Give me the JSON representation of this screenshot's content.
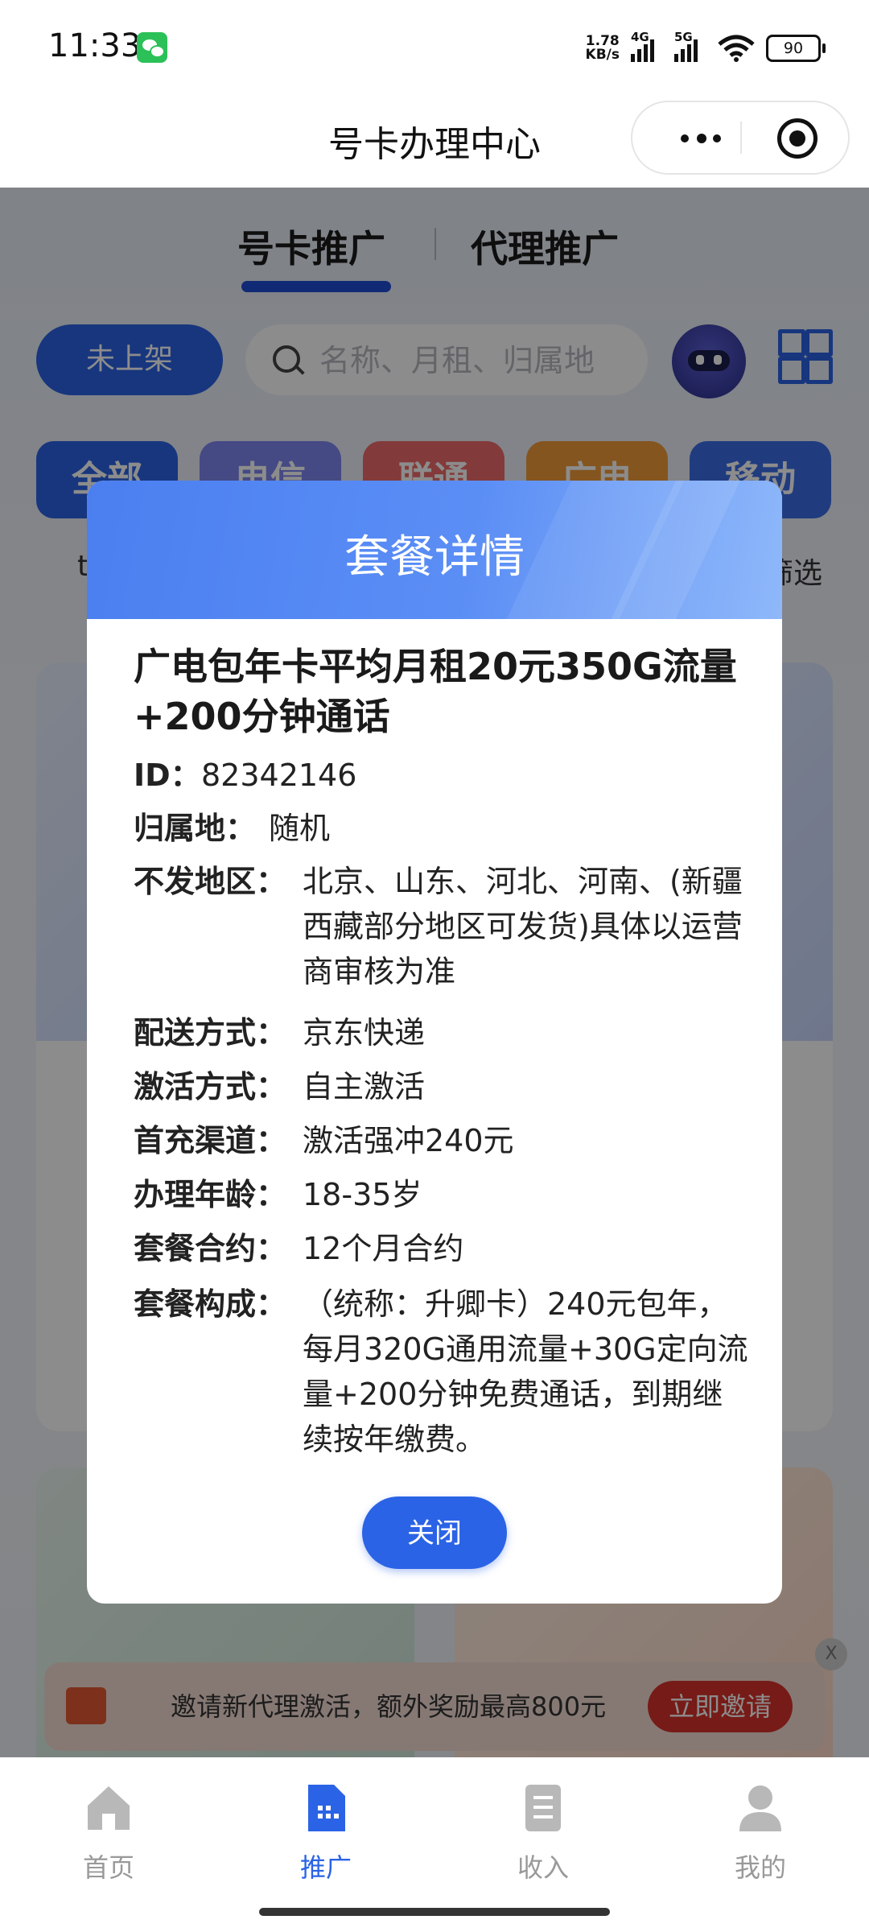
{
  "status_bar": {
    "time": "11:33",
    "net_speed_value": "1.78",
    "net_speed_unit": "KB/s",
    "sim1_tag": "4G",
    "sim2_tag": "5G",
    "battery": "90"
  },
  "title_bar": {
    "title": "号卡办理中心"
  },
  "tabs": {
    "active": "号卡推广",
    "other": "代理推广"
  },
  "filter": {
    "status_pill": "未上架",
    "search_placeholder": "名称、月租、归属地"
  },
  "carriers": [
    "全部",
    "电信",
    "联通",
    "广电",
    "移动"
  ],
  "sub_row": {
    "left_fragment": "t",
    "right_fragment": "筛选"
  },
  "invite": {
    "text": "邀请新代理激活，额外奖励最高800元",
    "button": "立即邀请",
    "close": "X"
  },
  "bottom_nav": [
    {
      "label": "首页",
      "icon": "home-icon",
      "active": false
    },
    {
      "label": "推广",
      "icon": "sim-card-icon",
      "active": true
    },
    {
      "label": "收入",
      "icon": "income-icon",
      "active": false
    },
    {
      "label": "我的",
      "icon": "profile-icon",
      "active": false
    }
  ],
  "modal": {
    "title": "套餐详情",
    "plan_name": "广电包年卡平均月租20元350G流量+200分钟通话",
    "id_label": "ID：",
    "id_value": "82342146",
    "home_label": "归属地：",
    "home_value": "随机",
    "excluded_label": "不发地区：",
    "excluded_value": "北京、山东、河北、河南、(新疆西藏部分地区可发货)具体以运营商审核为准",
    "delivery_label": "配送方式：",
    "delivery_value": "京东快递",
    "activation_label": "激活方式：",
    "activation_value": "自主激活",
    "topup_label": "首充渠道：",
    "topup_value": "激活强冲240元",
    "age_label": "办理年龄：",
    "age_value": "18-35岁",
    "contract_label": "套餐合约：",
    "contract_value": "12个月合约",
    "composition_label": "套餐构成：",
    "composition_value": "（统称：升卿卡）240元包年，每月320G通用流量+30G定向流量+200分钟免费通话，到期继续按年缴费。",
    "close_button": "关闭"
  },
  "colors": {
    "primary": "#2a63e6",
    "invite_red": "#d7322a",
    "carrier_all": "#2a63e6",
    "carrier_telecom": "#7f86f0",
    "carrier_unicom": "#ef6b6b",
    "carrier_broadcast": "#f09b3a",
    "carrier_mobile": "#3b6ee8"
  }
}
